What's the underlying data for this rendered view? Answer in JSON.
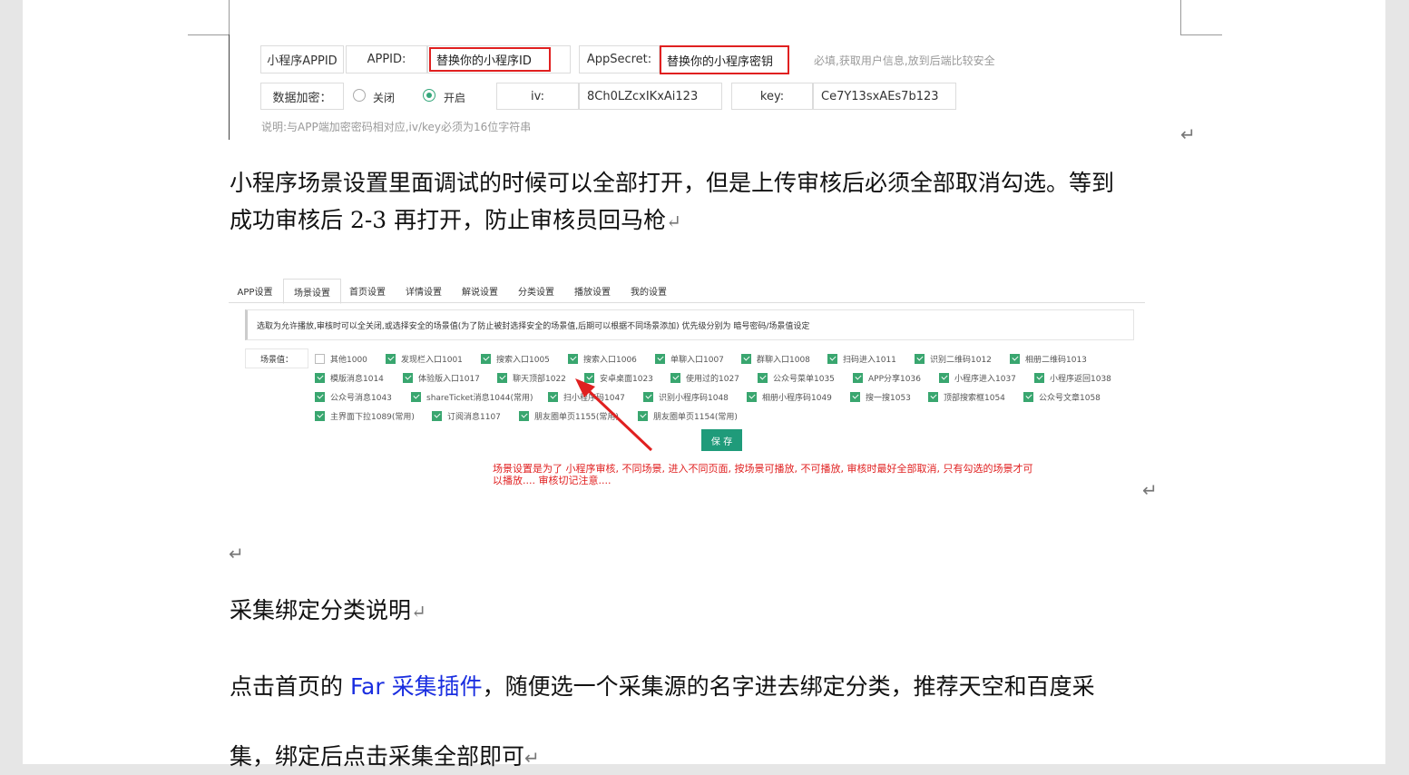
{
  "top_config": {
    "row1": {
      "label": "小程序APPID",
      "appid_label": "APPID:",
      "appid_value": "替换你的小程序ID",
      "secret_label": "AppSecret:",
      "secret_value": "替换你的小程序密钥",
      "hint": "必填,获取用户信息,放到后端比较安全"
    },
    "row2": {
      "label": "数据加密：",
      "option_off": "关闭",
      "option_on": "开启",
      "selected": "开启",
      "iv_label": "iv:",
      "iv_value": "8Ch0LZcxIKxAi123",
      "key_label": "key:",
      "key_value": "Ce7Y13sxAEs7b123"
    },
    "note": "说明:与APP端加密密码相对应,iv/key必须为16位字符串"
  },
  "paragraph1": {
    "line1": "小程序场景设置里面调试的时候可以全部打开，但是上传审核后必须全部取消勾选。等到",
    "line2": "成功审核后 2-3 再打开，防止审核员回马枪"
  },
  "scene_panel": {
    "tabs": [
      "APP设置",
      "场景设置",
      "首页设置",
      "详情设置",
      "解说设置",
      "分类设置",
      "播放设置",
      "我的设置"
    ],
    "active_tab": "场景设置",
    "notice": "选取为允许播放,审核时可以全关闭,或选择安全的场景值(为了防止被封选择安全的场景值,后期可以根据不同场景添加) 优先级分别为 暗号密码/场景值设定",
    "scene_label": "场景值：",
    "rows": [
      [
        {
          "label": "其他1000",
          "checked": false
        },
        {
          "label": "发现栏入口1001",
          "checked": true
        },
        {
          "label": "搜索入口1005",
          "checked": true
        },
        {
          "label": "搜索入口1006",
          "checked": true
        },
        {
          "label": "单聊入口1007",
          "checked": true
        },
        {
          "label": "群聊入口1008",
          "checked": true
        },
        {
          "label": "扫码进入1011",
          "checked": true
        },
        {
          "label": "识别二维码1012",
          "checked": true
        },
        {
          "label": "相册二维码1013",
          "checked": true
        }
      ],
      [
        {
          "label": "模版消息1014",
          "checked": true
        },
        {
          "label": "体验版入口1017",
          "checked": true
        },
        {
          "label": "聊天顶部1022",
          "checked": true
        },
        {
          "label": "安卓桌面1023",
          "checked": true
        },
        {
          "label": "使用过的1027",
          "checked": true
        },
        {
          "label": "公众号菜单1035",
          "checked": true
        },
        {
          "label": "APP分享1036",
          "checked": true
        },
        {
          "label": "小程序进入1037",
          "checked": true
        },
        {
          "label": "小程序返回1038",
          "checked": true
        }
      ],
      [
        {
          "label": "公众号消息1043",
          "checked": true
        },
        {
          "label": "shareTicket消息1044(常用)",
          "checked": true
        },
        {
          "label": "扫小程序码1047",
          "checked": true
        },
        {
          "label": "识别小程序码1048",
          "checked": true
        },
        {
          "label": "相册小程序码1049",
          "checked": true
        },
        {
          "label": "搜一搜1053",
          "checked": true
        },
        {
          "label": "顶部搜索框1054",
          "checked": true
        },
        {
          "label": "公众号文章1058",
          "checked": true
        }
      ],
      [
        {
          "label": "主界面下拉1089(常用)",
          "checked": true
        },
        {
          "label": "订阅消息1107",
          "checked": true
        },
        {
          "label": "朋友圈单页1155(常用)",
          "checked": true
        },
        {
          "label": "朋友圈单页1154(常用)",
          "checked": true
        }
      ]
    ],
    "save_label": "保 存",
    "annotation_line1": "场景设置是为了  小程序审核,  不同场景, 进入不同页面, 按场景可播放, 不可播放, 审核时最好全部取消,  只有勾选的场景才可",
    "annotation_line2": "以播放....        审核切记注意...."
  },
  "heading2": "采集绑定分类说明",
  "paragraph3": {
    "prefix": "点击首页的 ",
    "link": "Far 采集插件",
    "suffix": "，随便选一个采集源的名字进去绑定分类，推荐天空和百度采",
    "line2": "集，绑定后点击采集全部即可"
  },
  "colors": {
    "accent_green": "#39a66f",
    "save_button": "#1f9b7a",
    "highlight_red": "#e02020",
    "link_blue": "#1a2ee0"
  },
  "pilcrow": "↵"
}
